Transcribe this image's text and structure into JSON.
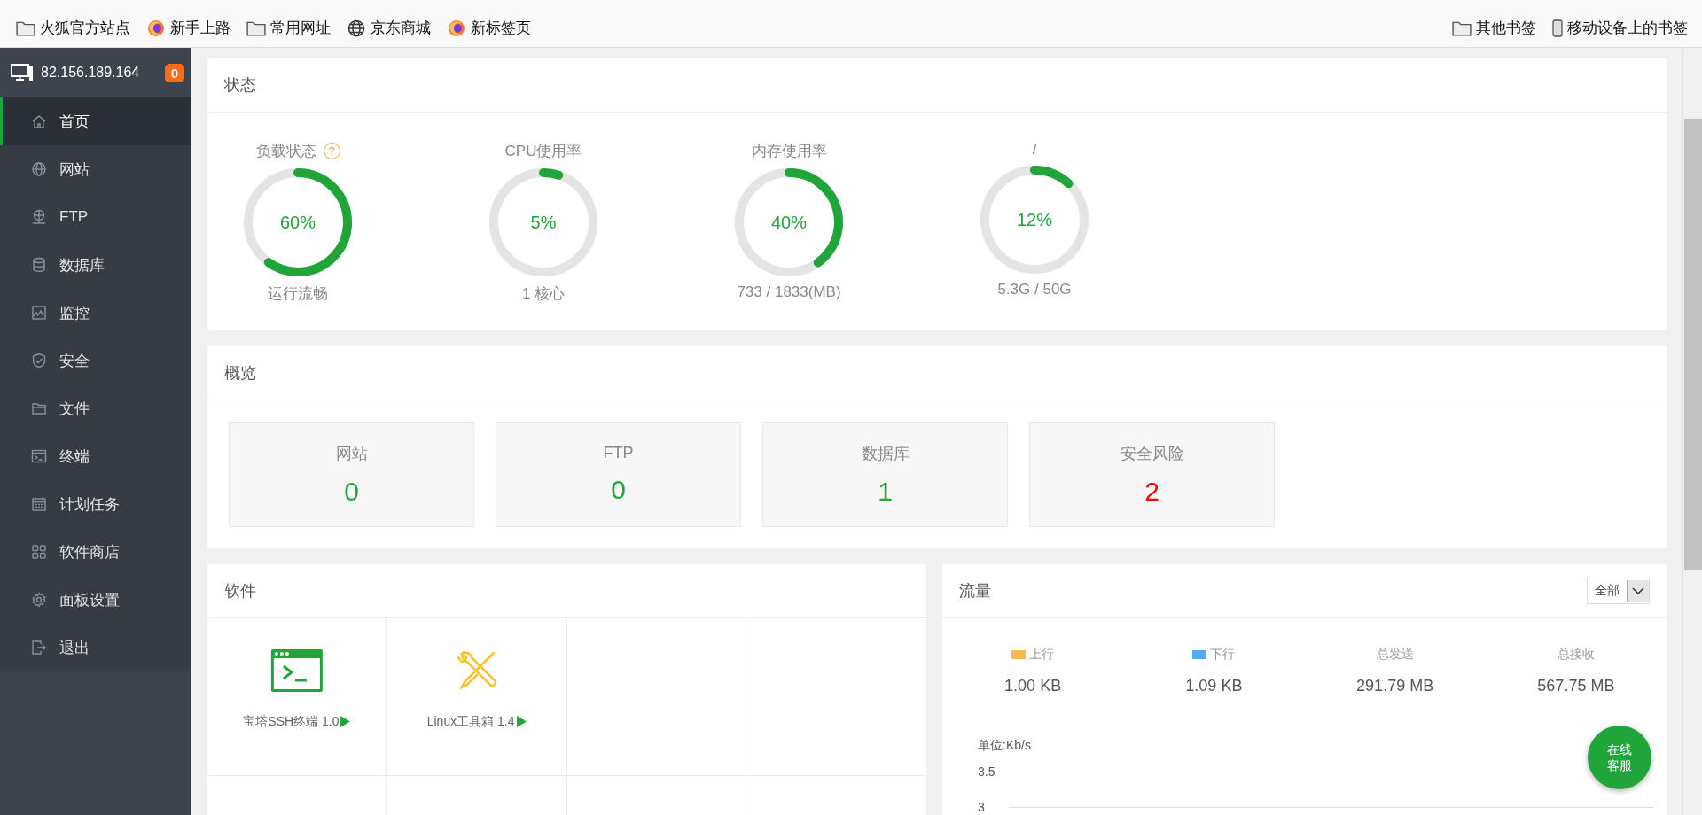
{
  "bookmarks": {
    "left": [
      {
        "kind": "folder",
        "label": "火狐官方站点"
      },
      {
        "kind": "firefox",
        "label": "新手上路"
      },
      {
        "kind": "folder",
        "label": "常用网址"
      },
      {
        "kind": "globe",
        "label": "京东商城"
      },
      {
        "kind": "firefox",
        "label": "新标签页"
      }
    ],
    "right": [
      {
        "kind": "folder",
        "label": "其他书签"
      },
      {
        "kind": "phone",
        "label": "移动设备上的书签"
      }
    ]
  },
  "sidebar": {
    "host": "82.156.189.164",
    "badge": "0",
    "items": [
      {
        "kind": "home",
        "label": "首页",
        "selected": true
      },
      {
        "kind": "globe",
        "label": "网站",
        "selected": false
      },
      {
        "kind": "ftp",
        "label": "FTP",
        "selected": false
      },
      {
        "kind": "database",
        "label": "数据库",
        "selected": false
      },
      {
        "kind": "monitor",
        "label": "监控",
        "selected": false
      },
      {
        "kind": "shield",
        "label": "安全",
        "selected": false
      },
      {
        "kind": "folder",
        "label": "文件",
        "selected": false
      },
      {
        "kind": "terminal",
        "label": "终端",
        "selected": false
      },
      {
        "kind": "calendar",
        "label": "计划任务",
        "selected": false
      },
      {
        "kind": "grid",
        "label": "软件商店",
        "selected": false
      },
      {
        "kind": "gear",
        "label": "面板设置",
        "selected": false
      },
      {
        "kind": "exit",
        "label": "退出",
        "selected": false
      }
    ]
  },
  "status": {
    "title": "状态",
    "gauges": [
      {
        "title": "负载状态",
        "help": "?",
        "value": "60%",
        "level": 0.6,
        "caption": "运行流畅"
      },
      {
        "title": "CPU使用率",
        "value": "5%",
        "level": 0.05,
        "caption": "1 核心"
      },
      {
        "title": "内存使用率",
        "value": "40%",
        "level": 0.4,
        "caption": "733 / 1833(MB)"
      },
      {
        "title": "/",
        "value": "12%",
        "level": 0.12,
        "caption": "5.3G / 50G"
      }
    ]
  },
  "overview": {
    "title": "概览",
    "items": [
      {
        "label": "网站",
        "value": "0",
        "color": "#20a53a"
      },
      {
        "label": "FTP",
        "value": "0",
        "color": "#20a53a"
      },
      {
        "label": "数据库",
        "value": "1",
        "color": "#20a53a"
      },
      {
        "label": "安全风险",
        "value": "2",
        "color": "#ff0000"
      }
    ]
  },
  "software": {
    "title": "软件",
    "items": [
      {
        "kind": "terminal",
        "name": "宝塔SSH终端 1.0"
      },
      {
        "kind": "toolbox",
        "name": "Linux工具箱 1.4"
      }
    ]
  },
  "traffic": {
    "title": "流量",
    "filter": "全部",
    "stats": [
      {
        "label": "上行",
        "value": "1.00 KB",
        "color": "#f7b851"
      },
      {
        "label": "下行",
        "value": "1.09 KB",
        "color": "#52a9ff"
      },
      {
        "label": "总发送",
        "value": "291.79 MB"
      },
      {
        "label": "总接收",
        "value": "567.75 MB"
      }
    ],
    "chart": {
      "unit": "单位:Kb/s",
      "yticks": [
        "3.5",
        "3"
      ]
    }
  },
  "support_button": [
    "在线",
    "客服"
  ]
}
